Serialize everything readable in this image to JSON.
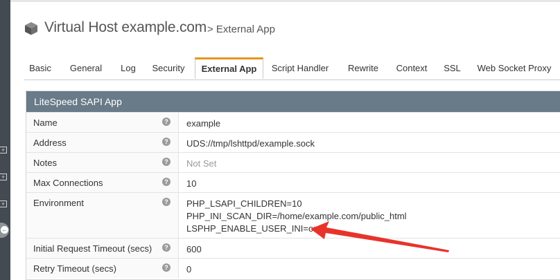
{
  "header": {
    "title": "Virtual Host example.com",
    "subtitle": "> External App",
    "icon": "cube-icon"
  },
  "tabs": [
    {
      "label": "Basic"
    },
    {
      "label": "General"
    },
    {
      "label": "Log"
    },
    {
      "label": "Security"
    },
    {
      "label": "External App",
      "active": true
    },
    {
      "label": "Script Handler"
    },
    {
      "label": "Rewrite"
    },
    {
      "label": "Context"
    },
    {
      "label": "SSL"
    },
    {
      "label": "Web Socket Proxy"
    }
  ],
  "panel": {
    "title": "LiteSpeed SAPI App",
    "rows": [
      {
        "label": "Name",
        "value": "example"
      },
      {
        "label": "Address",
        "value": "UDS://tmp/lshttpd/example.sock"
      },
      {
        "label": "Notes",
        "value": "Not Set"
      },
      {
        "label": "Max Connections",
        "value": "10"
      },
      {
        "label": "Environment",
        "lines": [
          "PHP_LSAPI_CHILDREN=10",
          "PHP_INI_SCAN_DIR=/home/example.com/public_html",
          "LSPHP_ENABLE_USER_INI=on"
        ]
      },
      {
        "label": "Initial Request Timeout (secs)",
        "value": "600"
      },
      {
        "label": "Retry Timeout (secs)",
        "value": "0"
      }
    ]
  },
  "sidebar": {
    "expand_icons": [
      "plus-square-icon",
      "plus-square-icon",
      "plus-square-icon"
    ],
    "back_icon": "arrow-left-circle-icon"
  },
  "colors": {
    "panel_header": "#697a88",
    "active_tab_accent": "#e6941f",
    "annotation_arrow": "#e8332b",
    "sidebar": "#444a51"
  }
}
